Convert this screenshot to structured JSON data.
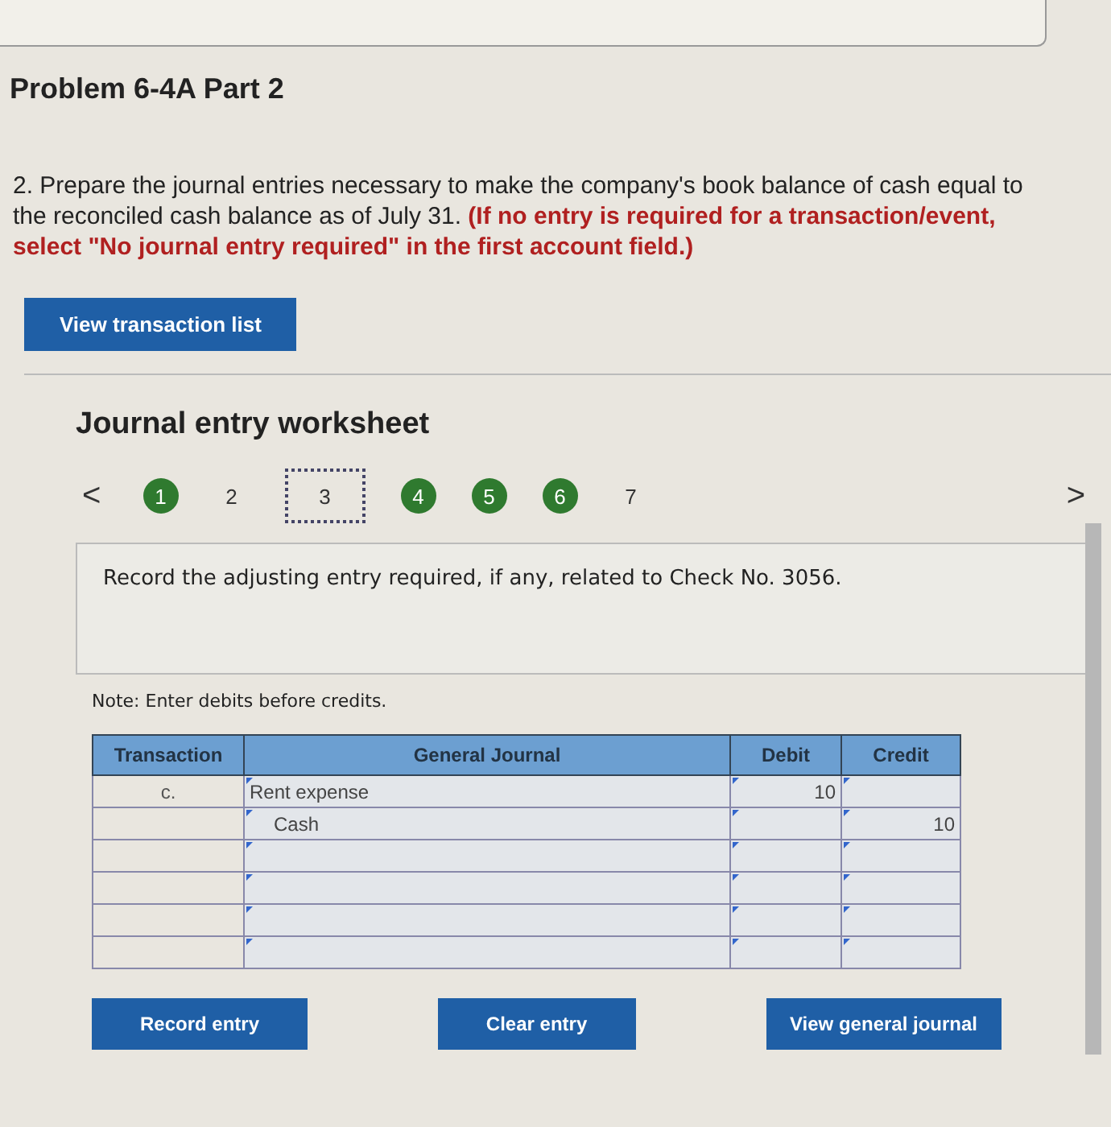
{
  "title": "Problem 6-4A Part 2",
  "instruction": "2. Prepare the journal entries necessary to make the company's book balance of cash equal to the reconciled cash balance as of July 31. **(If no entry is required for a transaction/event, select \"No journal entry required\" in the first account field.)**",
  "transaction_list_button": "View transaction list",
  "worksheet": {
    "heading": "Journal entry worksheet",
    "prev": "<",
    "next": ">",
    "steps": [
      {
        "label": "1",
        "completed": true,
        "selected": false
      },
      {
        "label": "2",
        "completed": false,
        "selected": false
      },
      {
        "label": "3",
        "completed": false,
        "selected": true
      },
      {
        "label": "4",
        "completed": true,
        "selected": false
      },
      {
        "label": "5",
        "completed": true,
        "selected": false
      },
      {
        "label": "6",
        "completed": true,
        "selected": false
      },
      {
        "label": "7",
        "completed": false,
        "selected": false
      }
    ],
    "prompt": "Record the adjusting entry required, if any, related to Check No. 3056.",
    "note": "Note: Enter debits before credits.",
    "table": {
      "columns": [
        "Transaction",
        "General Journal",
        "Debit",
        "Credit"
      ],
      "rows": [
        {
          "transaction": "c.",
          "account": "Rent expense",
          "indent": false,
          "debit": "10",
          "credit": ""
        },
        {
          "transaction": "",
          "account": "Cash",
          "indent": true,
          "debit": "",
          "credit": "10"
        },
        {
          "transaction": "",
          "account": "",
          "debit": "",
          "credit": ""
        },
        {
          "transaction": "",
          "account": "",
          "debit": "",
          "credit": ""
        },
        {
          "transaction": "",
          "account": "",
          "debit": "",
          "credit": ""
        },
        {
          "transaction": "",
          "account": "",
          "debit": "",
          "credit": ""
        }
      ]
    },
    "buttons": [
      "Record entry",
      "Clear entry",
      "View general journal"
    ]
  }
}
